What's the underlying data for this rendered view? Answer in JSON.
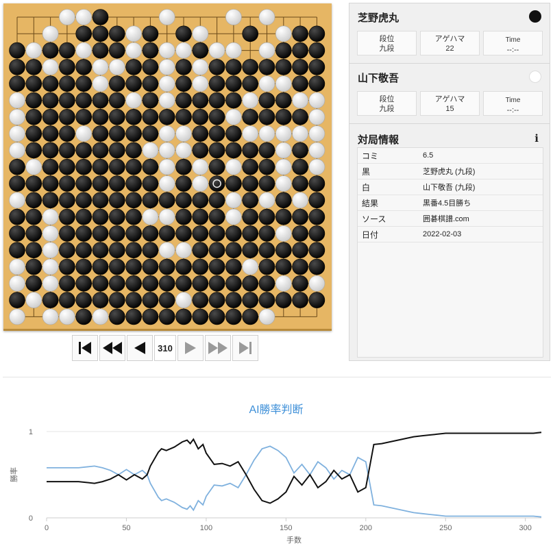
{
  "board": {
    "size": 19,
    "stone_rows": [
      "...wwb...w...w.w...",
      "..w.bbbwb.bw..b.wbb",
      "bwbbwbbwbwwbww.wbbb",
      "bbwbbwwbbwbwbbbbbbb",
      "bbbbbwbbbwbwbbbwwbb",
      "wbbbbbbwbwbbbbwbbww",
      "wbbbbbbbbbbbbwbbbbw",
      "wbbbwbbbbwwbbbwwwww",
      "wbbbbbbbwwwbbbbbwbw",
      "bwbbbbbbbwbwbwbbwbw",
      "bbbbbbbbbwbwbbbbwbb",
      "wbbbbbbbbbbbbwbwbwb",
      "bbwbbbbbwwbbbwbbbbb",
      "bbwbbbbbbbbbbbbbwbb",
      "bbwbbbbbbwwbbbbbbbb",
      "wbwbbbbbbbbbbbwbbbb",
      "wbwbbbbbbbbbbbbbwbw",
      "bwbbbbbbbbwbbbbbbbb",
      "w.wwbwbbbbbbbbbw..."
    ],
    "last_move": [
      10,
      12
    ],
    "star_points": [
      [
        3,
        3
      ],
      [
        3,
        9
      ],
      [
        3,
        15
      ],
      [
        9,
        3
      ],
      [
        9,
        9
      ],
      [
        9,
        15
      ],
      [
        15,
        3
      ],
      [
        15,
        9
      ],
      [
        15,
        15
      ]
    ]
  },
  "navigation": {
    "first_icon": "skip-to-start-icon",
    "back_many_icon": "fast-backward-icon",
    "back_icon": "step-backward-icon",
    "move_number": "310",
    "forward_icon": "step-forward-icon",
    "forward_many_icon": "fast-forward-icon",
    "last_icon": "skip-to-end-icon"
  },
  "players": {
    "black": {
      "name": "芝野虎丸",
      "rank_label": "段位",
      "rank": "九段",
      "captures_label": "アゲハマ",
      "captures": "22",
      "time_label": "Time",
      "time": "--:--"
    },
    "white": {
      "name": "山下敬吾",
      "rank_label": "段位",
      "rank": "九段",
      "captures_label": "アゲハマ",
      "captures": "15",
      "time_label": "Time",
      "time": "--:--"
    }
  },
  "game_info": {
    "title": "対局情報",
    "info_icon": "info-icon",
    "rows": [
      {
        "key": "コミ",
        "value": "6.5"
      },
      {
        "key": "黒",
        "value": "芝野虎丸 (九段)"
      },
      {
        "key": "白",
        "value": "山下敬吾 (九段)"
      },
      {
        "key": "結果",
        "value": "黒番4.5目勝ち"
      },
      {
        "key": "ソース",
        "value": "囲碁棋譜.com"
      },
      {
        "key": "日付",
        "value": "2022-02-03"
      }
    ]
  },
  "colors": {
    "board": "#e6b664",
    "black_line": "#111111",
    "white_line": "#7fb1de",
    "chart_title": "#3d8fd8"
  },
  "chart_data": {
    "type": "line",
    "title": "AI勝率判断",
    "xlabel": "手数",
    "ylabel": "勝率",
    "xlim": [
      0,
      310
    ],
    "ylim": [
      0,
      1
    ],
    "xticks": [
      0,
      50,
      100,
      150,
      200,
      250,
      300
    ],
    "yticks": [
      0,
      1
    ],
    "series": [
      {
        "name": "black",
        "x": [
          0,
          10,
          20,
          30,
          35,
          40,
          45,
          50,
          55,
          60,
          63,
          65,
          70,
          72,
          75,
          80,
          85,
          88,
          90,
          92,
          95,
          98,
          100,
          105,
          110,
          115,
          120,
          125,
          130,
          135,
          140,
          145,
          150,
          155,
          160,
          165,
          170,
          175,
          180,
          185,
          190,
          195,
          200,
          202,
          205,
          210,
          215,
          220,
          225,
          230,
          235,
          240,
          245,
          250,
          260,
          270,
          280,
          290,
          300,
          305,
          310
        ],
        "y": [
          0.42,
          0.42,
          0.42,
          0.4,
          0.42,
          0.45,
          0.5,
          0.44,
          0.5,
          0.45,
          0.5,
          0.6,
          0.76,
          0.8,
          0.78,
          0.82,
          0.88,
          0.9,
          0.86,
          0.91,
          0.8,
          0.85,
          0.75,
          0.62,
          0.63,
          0.6,
          0.65,
          0.5,
          0.33,
          0.2,
          0.17,
          0.22,
          0.3,
          0.48,
          0.38,
          0.5,
          0.35,
          0.42,
          0.55,
          0.45,
          0.5,
          0.3,
          0.35,
          0.55,
          0.85,
          0.86,
          0.88,
          0.9,
          0.92,
          0.94,
          0.95,
          0.96,
          0.97,
          0.98,
          0.98,
          0.98,
          0.98,
          0.98,
          0.98,
          0.98,
          0.99
        ]
      },
      {
        "name": "white",
        "x": [
          0,
          10,
          20,
          30,
          35,
          40,
          45,
          50,
          55,
          60,
          63,
          65,
          70,
          72,
          75,
          80,
          85,
          88,
          90,
          92,
          95,
          98,
          100,
          105,
          110,
          115,
          120,
          125,
          130,
          135,
          140,
          145,
          150,
          155,
          160,
          165,
          170,
          175,
          180,
          185,
          190,
          195,
          200,
          202,
          205,
          210,
          215,
          220,
          225,
          230,
          235,
          240,
          245,
          250,
          260,
          270,
          280,
          290,
          300,
          305,
          310
        ],
        "y": [
          0.58,
          0.58,
          0.58,
          0.6,
          0.58,
          0.55,
          0.5,
          0.56,
          0.5,
          0.55,
          0.5,
          0.4,
          0.24,
          0.2,
          0.22,
          0.18,
          0.12,
          0.1,
          0.14,
          0.09,
          0.2,
          0.15,
          0.25,
          0.38,
          0.37,
          0.4,
          0.35,
          0.5,
          0.67,
          0.8,
          0.83,
          0.78,
          0.7,
          0.52,
          0.62,
          0.5,
          0.65,
          0.58,
          0.45,
          0.55,
          0.5,
          0.7,
          0.65,
          0.45,
          0.15,
          0.14,
          0.12,
          0.1,
          0.08,
          0.06,
          0.05,
          0.04,
          0.03,
          0.02,
          0.02,
          0.02,
          0.02,
          0.02,
          0.02,
          0.02,
          0.01
        ]
      }
    ],
    "grid": true
  }
}
